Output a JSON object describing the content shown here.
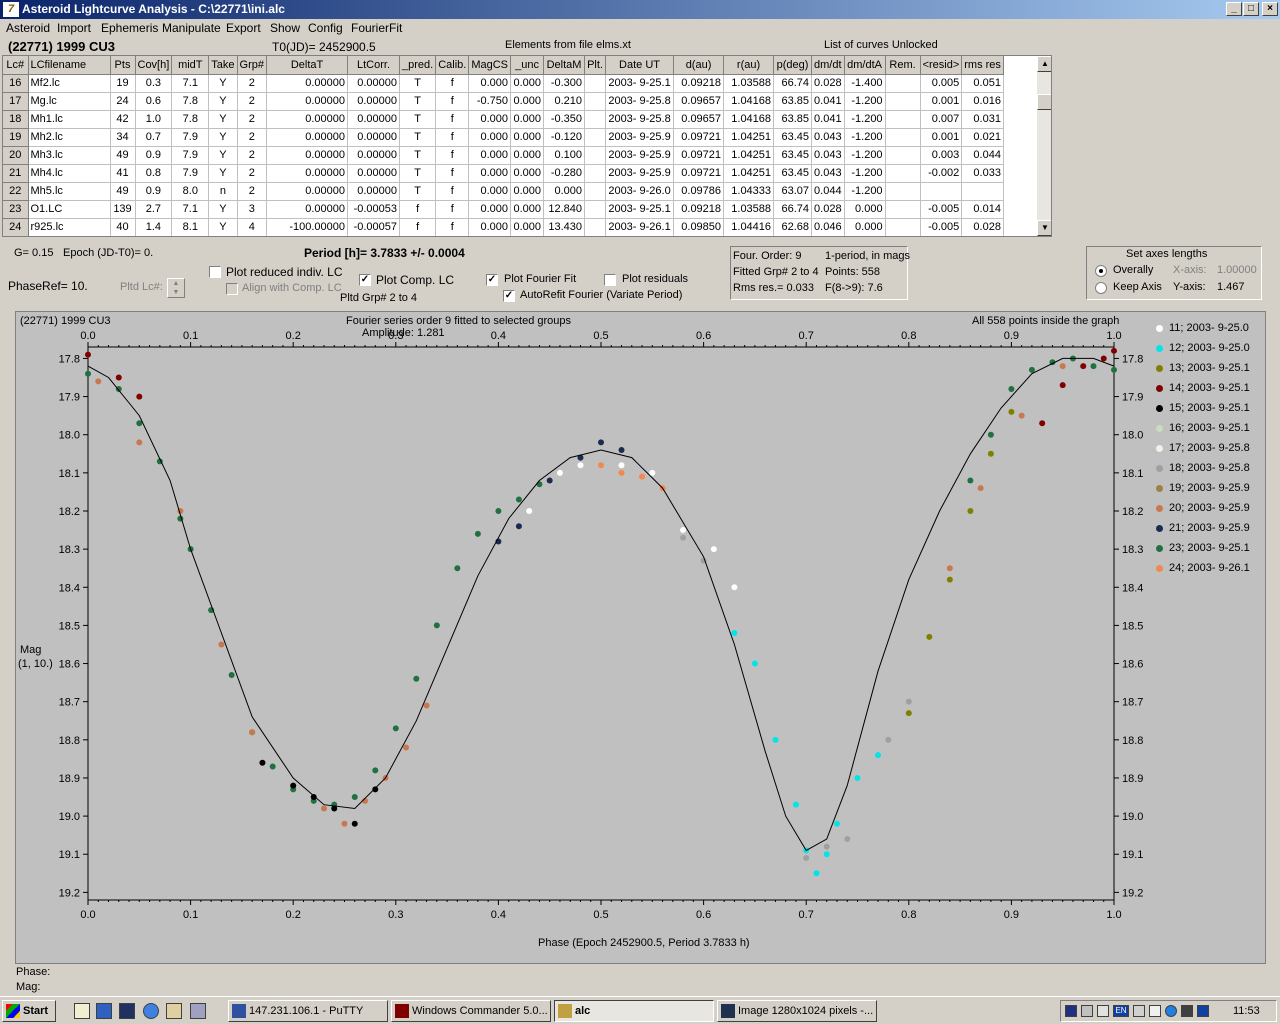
{
  "window": {
    "title": "Asteroid Lightcurve Analysis - C:\\22771\\ini.alc",
    "app_icon": "7"
  },
  "menu": [
    "Asteroid",
    "Import",
    "Ephemeris",
    "Manipulate",
    "Export",
    "Show",
    "Config",
    "FourierFit"
  ],
  "header": {
    "object": "(22771) 1999 CU3",
    "t0": "T0(JD)= 2452900.5",
    "elements": "Elements from file elms.xt",
    "curves": "List of curves Unlocked"
  },
  "table": {
    "columns": [
      "Lc#",
      "LCfilename",
      "Pts",
      "Cov[h]",
      "midT",
      "Take",
      "Grp#",
      "DeltaT",
      "LtCorr.",
      "_pred.",
      "Calib.",
      "MagCS",
      "_unc",
      "DeltaM",
      "Plt.",
      "Date UT",
      "d(au)",
      "r(au)",
      "p(deg)",
      "dm/dt",
      "dm/dtA",
      "Rem.",
      "<resid>",
      "rms res"
    ],
    "rows": [
      [
        "16",
        "Mf2.lc",
        "19",
        "0.3",
        "7.1",
        "Y",
        "2",
        "0.00000",
        "0.00000",
        "T",
        "f",
        "0.000",
        "0.000",
        "-0.300",
        "",
        "2003- 9-25.1",
        "0.09218",
        "1.03588",
        "66.74",
        "0.028",
        "-1.400",
        "",
        "0.005",
        "0.051"
      ],
      [
        "17",
        "Mg.lc",
        "24",
        "0.6",
        "7.8",
        "Y",
        "2",
        "0.00000",
        "0.00000",
        "T",
        "f",
        "-0.750",
        "0.000",
        "0.210",
        "",
        "2003- 9-25.8",
        "0.09657",
        "1.04168",
        "63.85",
        "0.041",
        "-1.200",
        "",
        "0.001",
        "0.016"
      ],
      [
        "18",
        "Mh1.lc",
        "42",
        "1.0",
        "7.8",
        "Y",
        "2",
        "0.00000",
        "0.00000",
        "T",
        "f",
        "0.000",
        "0.000",
        "-0.350",
        "",
        "2003- 9-25.8",
        "0.09657",
        "1.04168",
        "63.85",
        "0.041",
        "-1.200",
        "",
        "0.007",
        "0.031"
      ],
      [
        "19",
        "Mh2.lc",
        "34",
        "0.7",
        "7.9",
        "Y",
        "2",
        "0.00000",
        "0.00000",
        "T",
        "f",
        "0.000",
        "0.000",
        "-0.120",
        "",
        "2003- 9-25.9",
        "0.09721",
        "1.04251",
        "63.45",
        "0.043",
        "-1.200",
        "",
        "0.001",
        "0.021"
      ],
      [
        "20",
        "Mh3.lc",
        "49",
        "0.9",
        "7.9",
        "Y",
        "2",
        "0.00000",
        "0.00000",
        "T",
        "f",
        "0.000",
        "0.000",
        "0.100",
        "",
        "2003- 9-25.9",
        "0.09721",
        "1.04251",
        "63.45",
        "0.043",
        "-1.200",
        "",
        "0.003",
        "0.044"
      ],
      [
        "21",
        "Mh4.lc",
        "41",
        "0.8",
        "7.9",
        "Y",
        "2",
        "0.00000",
        "0.00000",
        "T",
        "f",
        "0.000",
        "0.000",
        "-0.280",
        "",
        "2003- 9-25.9",
        "0.09721",
        "1.04251",
        "63.45",
        "0.043",
        "-1.200",
        "",
        "-0.002",
        "0.033"
      ],
      [
        "22",
        "Mh5.lc",
        "49",
        "0.9",
        "8.0",
        "n",
        "2",
        "0.00000",
        "0.00000",
        "T",
        "f",
        "0.000",
        "0.000",
        "0.000",
        "",
        "2003- 9-26.0",
        "0.09786",
        "1.04333",
        "63.07",
        "0.044",
        "-1.200",
        "",
        "",
        ""
      ],
      [
        "23",
        "O1.LC",
        "139",
        "2.7",
        "7.1",
        "Y",
        "3",
        "0.00000",
        "-0.00053",
        "f",
        "f",
        "0.000",
        "0.000",
        "12.840",
        "",
        "2003- 9-25.1",
        "0.09218",
        "1.03588",
        "66.74",
        "0.028",
        "0.000",
        "",
        "-0.005",
        "0.014"
      ],
      [
        "24",
        "r925.lc",
        "40",
        "1.4",
        "8.1",
        "Y",
        "4",
        "-100.00000",
        "-0.00057",
        "f",
        "f",
        "0.000",
        "0.000",
        "13.430",
        "",
        "2003- 9-26.1",
        "0.09850",
        "1.04416",
        "62.68",
        "0.046",
        "0.000",
        "",
        "-0.005",
        "0.028"
      ]
    ]
  },
  "controls": {
    "g": "G= 0.15",
    "epoch": "Epoch (JD-T0)= 0.",
    "period": "Period [h]= 3.7833 +/- 0.0004",
    "phaseref": "PhaseRef= 10.",
    "pltd_lc": "Pltd Lc#:",
    "plot_reduced": "Plot reduced indiv. LC",
    "align_comp": "Align with Comp. LC",
    "plot_comp": "Plot Comp. LC",
    "pltd_grp": "Pltd Grp#  2  to   4",
    "plot_fourier": "Plot Fourier Fit",
    "plot_residuals": "Plot residuals",
    "autorefit": "AutoRefit Fourier (Variate Period)"
  },
  "fourier_info": {
    "order": "Four. Order:  9",
    "period_mode": "1-period, in mags",
    "fitted": "Fitted Grp# 2 to 4",
    "points": "Points: 558",
    "rms": "Rms res.= 0.033",
    "f": "F(8->9):   7.6"
  },
  "axes_box": {
    "title": "Set axes lengths",
    "overally": "Overally",
    "keep_axis": "Keep Axis",
    "x_label": "X-axis:",
    "x_value": "1.00000",
    "y_label": "Y-axis:",
    "y_value": "1.467"
  },
  "plot": {
    "object": "(22771) 1999 CU3",
    "fourier_title": "Fourier series order 9 fitted to selected groups",
    "amplitude": "Amplitude: 1.281",
    "points_note": "All 558 points inside the graph",
    "ylabel": "Mag",
    "ylabel2": "(1, 10.)",
    "xlabel": "Phase (Epoch 2452900.5, Period 3.7833 h)"
  },
  "chart_data": {
    "type": "scatter",
    "title": "Fourier series order 9 fitted to selected groups",
    "xlabel": "Phase (Epoch 2452900.5, Period 3.7833 h)",
    "ylabel": "Mag",
    "xlim": [
      0.0,
      1.0
    ],
    "ylim": [
      19.22,
      17.77
    ],
    "x_ticks": [
      "0.0",
      "0.1",
      "0.2",
      "0.3",
      "0.4",
      "0.5",
      "0.6",
      "0.7",
      "0.8",
      "0.9",
      "1.0"
    ],
    "y_ticks": [
      "17.8",
      "17.9",
      "18.0",
      "18.1",
      "18.2",
      "18.3",
      "18.4",
      "18.5",
      "18.6",
      "18.7",
      "18.8",
      "18.9",
      "19.0",
      "19.1",
      "19.2"
    ],
    "fit_curve": {
      "x": [
        0.0,
        0.02,
        0.05,
        0.08,
        0.1,
        0.13,
        0.16,
        0.2,
        0.23,
        0.26,
        0.29,
        0.32,
        0.35,
        0.38,
        0.41,
        0.44,
        0.47,
        0.5,
        0.53,
        0.56,
        0.6,
        0.63,
        0.66,
        0.68,
        0.7,
        0.72,
        0.74,
        0.77,
        0.8,
        0.83,
        0.86,
        0.89,
        0.92,
        0.95,
        0.98,
        1.0
      ],
      "y": [
        17.82,
        17.85,
        17.95,
        18.12,
        18.3,
        18.52,
        18.74,
        18.9,
        18.97,
        18.98,
        18.9,
        18.75,
        18.56,
        18.37,
        18.22,
        18.12,
        18.06,
        18.04,
        18.06,
        18.14,
        18.32,
        18.55,
        18.83,
        19.0,
        19.09,
        19.06,
        18.92,
        18.62,
        18.38,
        18.2,
        18.05,
        17.93,
        17.84,
        17.8,
        17.8,
        17.82
      ]
    },
    "legend": [
      {
        "label": "11; 2003- 9-25.0",
        "color": "#ffffff"
      },
      {
        "label": "12; 2003- 9-25.0",
        "color": "#00e5e5"
      },
      {
        "label": "13; 2003- 9-25.1",
        "color": "#808000"
      },
      {
        "label": "14; 2003- 9-25.1",
        "color": "#800000"
      },
      {
        "label": "15; 2003- 9-25.1",
        "color": "#000000"
      },
      {
        "label": "16; 2003- 9-25.1",
        "color": "#c8dcc0"
      },
      {
        "label": "17; 2003- 9-25.8",
        "color": "#f4f0e8"
      },
      {
        "label": "18; 2003- 9-25.8",
        "color": "#a0a0a0"
      },
      {
        "label": "19; 2003- 9-25.9",
        "color": "#a08040"
      },
      {
        "label": "20; 2003- 9-25.9",
        "color": "#c87850"
      },
      {
        "label": "21; 2003- 9-25.9",
        "color": "#1a2a50"
      },
      {
        "label": "23; 2003- 9-25.1",
        "color": "#207040"
      },
      {
        "label": "24; 2003- 9-26.1",
        "color": "#f08850"
      }
    ],
    "series": [
      {
        "color": "#207040",
        "x": [
          0.0,
          0.03,
          0.05,
          0.07,
          0.09,
          0.1,
          0.12,
          0.14,
          0.16,
          0.18,
          0.2,
          0.22,
          0.24,
          0.26,
          0.28,
          0.3,
          0.32,
          0.34,
          0.36,
          0.38,
          0.4,
          0.42,
          0.44,
          0.86,
          0.88,
          0.9,
          0.92,
          0.94,
          0.96,
          0.98,
          1.0
        ],
        "y": [
          17.84,
          17.88,
          17.97,
          18.07,
          18.22,
          18.3,
          18.46,
          18.63,
          18.78,
          18.87,
          18.93,
          18.96,
          18.97,
          18.95,
          18.88,
          18.77,
          18.64,
          18.5,
          18.35,
          18.26,
          18.2,
          18.17,
          18.13,
          18.12,
          18.0,
          17.88,
          17.83,
          17.81,
          17.8,
          17.82,
          17.83
        ]
      },
      {
        "color": "#c87850",
        "x": [
          0.01,
          0.05,
          0.09,
          0.13,
          0.16,
          0.2,
          0.23,
          0.25,
          0.27,
          0.29,
          0.31,
          0.33,
          0.84,
          0.87,
          0.91,
          0.95
        ],
        "y": [
          17.86,
          18.02,
          18.2,
          18.55,
          18.78,
          18.92,
          18.98,
          19.02,
          18.96,
          18.9,
          18.82,
          18.71,
          18.35,
          18.14,
          17.95,
          17.82
        ]
      },
      {
        "color": "#000000",
        "x": [
          0.17,
          0.2,
          0.22,
          0.24,
          0.26,
          0.28
        ],
        "y": [
          18.86,
          18.92,
          18.95,
          18.98,
          19.02,
          18.93
        ]
      },
      {
        "color": "#1a2a50",
        "x": [
          0.4,
          0.42,
          0.45,
          0.48,
          0.5,
          0.52
        ],
        "y": [
          18.28,
          18.24,
          18.12,
          18.06,
          18.02,
          18.04
        ]
      },
      {
        "color": "#ffffff",
        "x": [
          0.43,
          0.46,
          0.48,
          0.52,
          0.55,
          0.58,
          0.61,
          0.63
        ],
        "y": [
          18.2,
          18.1,
          18.08,
          18.08,
          18.1,
          18.25,
          18.3,
          18.4
        ]
      },
      {
        "color": "#f08850",
        "x": [
          0.5,
          0.52,
          0.54,
          0.56
        ],
        "y": [
          18.08,
          18.1,
          18.11,
          18.14
        ]
      },
      {
        "color": "#00e5e5",
        "x": [
          0.63,
          0.65,
          0.67,
          0.69,
          0.7,
          0.71,
          0.72,
          0.73,
          0.75,
          0.77
        ],
        "y": [
          18.52,
          18.6,
          18.8,
          18.97,
          19.09,
          19.15,
          19.1,
          19.02,
          18.9,
          18.84
        ]
      },
      {
        "color": "#a0a0a0",
        "x": [
          0.58,
          0.6,
          0.7,
          0.72,
          0.74,
          0.78,
          0.8
        ],
        "y": [
          18.27,
          18.33,
          19.11,
          19.08,
          19.06,
          18.8,
          18.7
        ]
      },
      {
        "color": "#808000",
        "x": [
          0.8,
          0.82,
          0.84,
          0.86,
          0.88,
          0.9
        ],
        "y": [
          18.73,
          18.53,
          18.38,
          18.2,
          18.05,
          17.94
        ]
      },
      {
        "color": "#800000",
        "x": [
          0.0,
          0.03,
          0.05,
          0.93,
          0.95,
          0.97,
          0.99,
          1.0
        ],
        "y": [
          17.79,
          17.85,
          17.9,
          17.97,
          17.87,
          17.82,
          17.8,
          17.78
        ]
      }
    ]
  },
  "legend_labels": [
    "11; 2003- 9-25.0",
    "12; 2003- 9-25.0",
    "13; 2003- 9-25.1",
    "14; 2003- 9-25.1",
    "15; 2003- 9-25.1",
    "16; 2003- 9-25.1",
    "17; 2003- 9-25.8",
    "18; 2003- 9-25.8",
    "19; 2003- 9-25.9",
    "20; 2003- 9-25.9",
    "21; 2003- 9-25.9",
    "23; 2003- 9-25.1",
    "24; 2003- 9-26.1"
  ],
  "footer": {
    "phase": "Phase:",
    "mag": "Mag:"
  },
  "taskbar": {
    "start": "Start",
    "buttons": [
      "147.231.106.1 - PuTTY",
      "Windows Commander 5.0...",
      "alc",
      "Image 1280x1024 pixels -..."
    ],
    "tray_lang": "EN",
    "clock": "11:53"
  }
}
